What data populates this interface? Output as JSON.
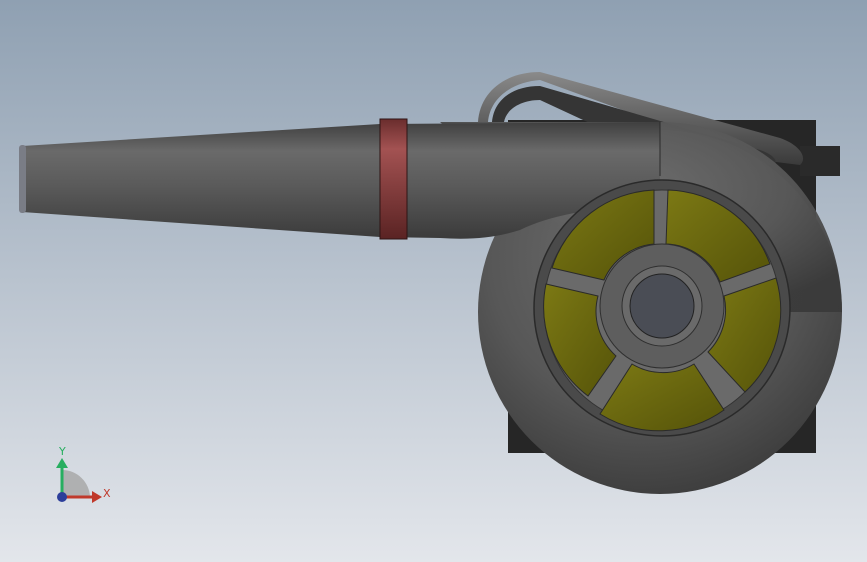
{
  "viewport": {
    "background_top": "#8fa0b2",
    "background_bottom": "#e3e6eb"
  },
  "triad": {
    "x_label": "X",
    "y_label": "Y",
    "x_color": "#c0392b",
    "y_color": "#27ae60",
    "z_color": "#2c3e9a"
  },
  "model": {
    "body_color": "#5b5b5b",
    "band_color": "#8a3c3c",
    "grille_color": "#6d6a0f",
    "hub_color": "#4a4d55",
    "frame_color": "#2b2b2b"
  }
}
